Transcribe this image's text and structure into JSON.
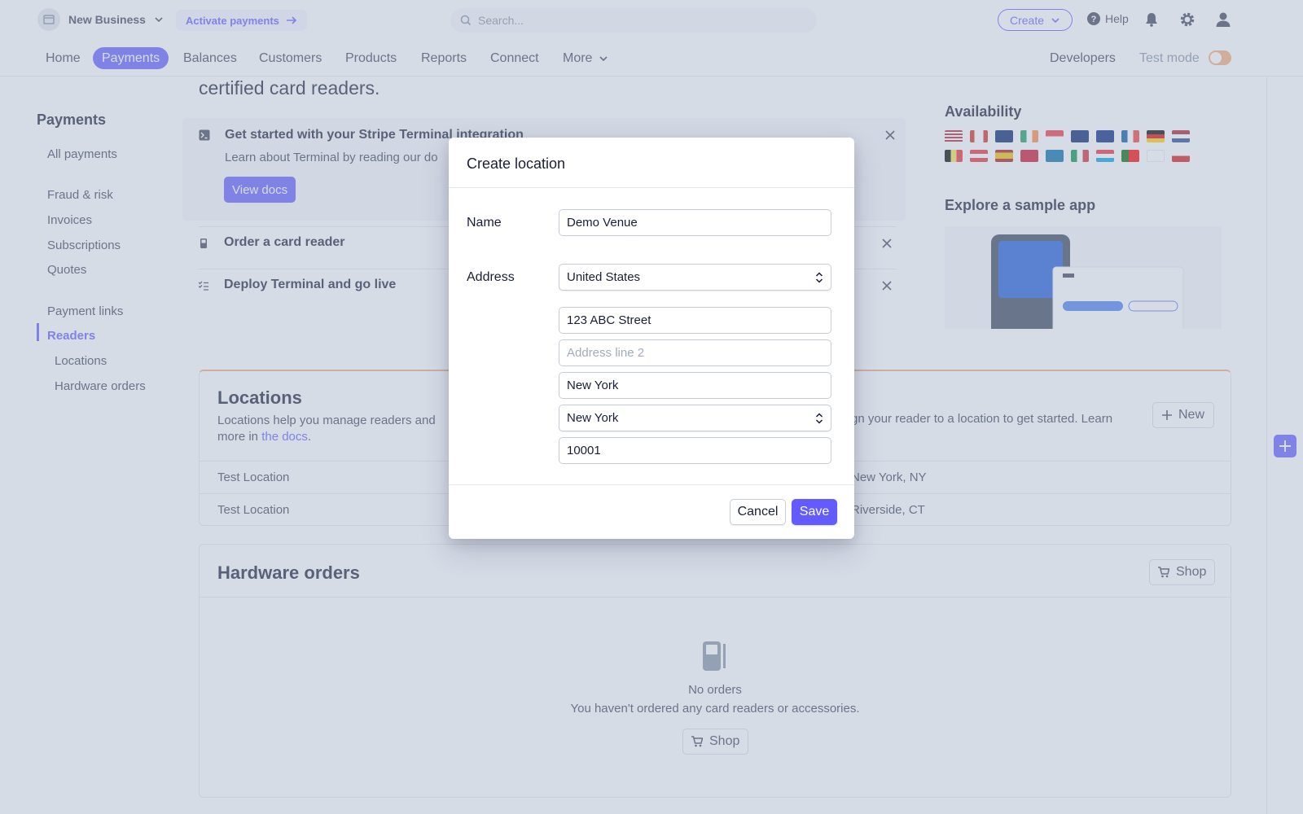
{
  "topbar": {
    "business_name": "New Business",
    "activate_label": "Activate payments",
    "search_placeholder": "Search...",
    "create_label": "Create",
    "help_label": "Help"
  },
  "nav": {
    "items": [
      "Home",
      "Payments",
      "Balances",
      "Customers",
      "Products",
      "Reports",
      "Connect",
      "More"
    ],
    "active": "Payments",
    "developers": "Developers",
    "test_mode": "Test mode"
  },
  "sidebar": {
    "title": "Payments",
    "items": [
      "All payments",
      "Fraud & risk",
      "Invoices",
      "Subscriptions",
      "Quotes",
      "Payment links",
      "Readers",
      "Locations",
      "Hardware orders"
    ],
    "active": "Readers"
  },
  "main": {
    "headline": "certified card readers.",
    "getting_started": {
      "title": "Get started with your Stripe Terminal integration",
      "text": "Learn about Terminal by reading our do",
      "button": "View docs"
    },
    "steps": [
      "Order a card reader",
      "Deploy Terminal and go live"
    ],
    "availability_title": "Availability",
    "explore_title": "Explore a sample app",
    "locations": {
      "title": "Locations",
      "desc_left": "Locations help you manage readers and",
      "desc_right": "gn your reader to a location to get started. Learn",
      "desc_more": "more in ",
      "desc_link": "the docs",
      "desc_end": ".",
      "new_button": "New",
      "rows": [
        {
          "name": "Test Location",
          "city": "New York, NY"
        },
        {
          "name": "Test Location",
          "city": "Riverside, CT"
        }
      ]
    },
    "hardware": {
      "title": "Hardware orders",
      "shop_label": "Shop",
      "empty_title": "No orders",
      "empty_text": "You haven't ordered any card readers or accessories."
    }
  },
  "modal": {
    "title": "Create location",
    "name_label": "Name",
    "name_value": "Demo Venue",
    "address_label": "Address",
    "country": "United States",
    "line1": "123 ABC Street",
    "line2_placeholder": "Address line 2",
    "city": "New York",
    "state": "New York",
    "zip": "10001",
    "cancel": "Cancel",
    "save": "Save"
  },
  "colors": {
    "accent": "#635bff",
    "test_mode_toggle": "#f5a97a",
    "text": "#1a1f36"
  }
}
